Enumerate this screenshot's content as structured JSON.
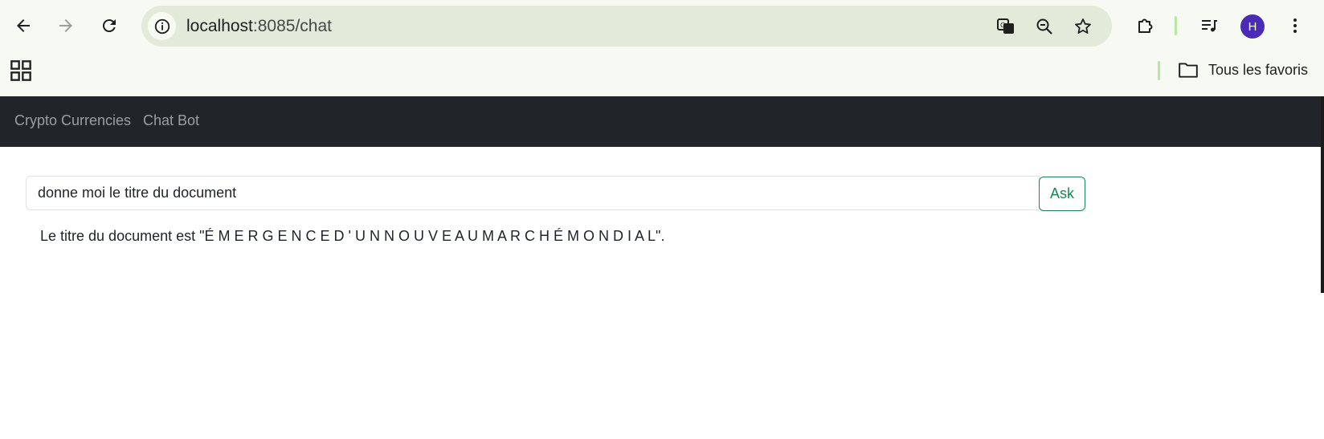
{
  "browser": {
    "url_host": "localhost",
    "url_rest": ":8085/chat",
    "profile_initial": "H",
    "bookmarks_folder_label": "Tous les favoris",
    "icons": {
      "back": "arrow-left-icon",
      "forward": "arrow-right-icon",
      "reload": "reload-icon",
      "site_info": "info-icon",
      "translate": "translate-icon",
      "zoom": "zoom-out-icon",
      "bookmark": "star-icon",
      "extensions": "puzzle-icon",
      "media": "media-queue-icon",
      "menu": "kebab-menu-icon",
      "apps": "apps-grid-icon",
      "folder": "folder-icon"
    },
    "colors": {
      "chrome_bg": "#f7faf2",
      "omnibox_bg": "#e3ead9",
      "avatar": "#4a2bb5",
      "separator": "#b8e6a3"
    }
  },
  "navbar": {
    "links": [
      "Crypto Currencies",
      "Chat Bot"
    ],
    "bg": "#212529"
  },
  "chat": {
    "input_value": "donne moi le titre du document",
    "ask_label": "Ask",
    "answer": "Le titre du document est \"É M E R G E N C E D ' U N N O U V E A U M A R C H É M O N D I A L\".",
    "accent": "#198754"
  }
}
